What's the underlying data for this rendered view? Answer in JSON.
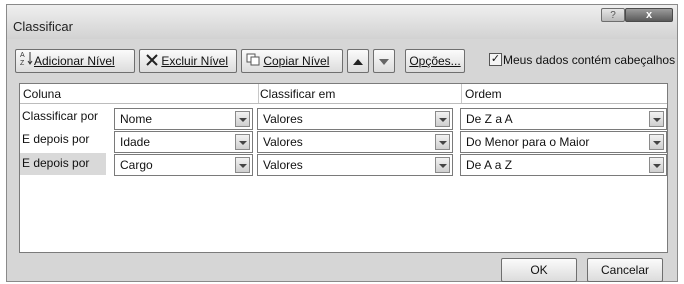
{
  "window": {
    "title": "Classificar",
    "help_label": "?",
    "close_label": "x"
  },
  "toolbar": {
    "add_level": "Adicionar Nível",
    "delete_level": "Excluir Nível",
    "copy_level": "Copiar Nível",
    "move_up_icon": "triangle-up-icon",
    "move_down_icon": "triangle-down-icon",
    "options": "Opções...",
    "has_headers_label": "Meus dados contém cabeçalhos",
    "has_headers_checked": true
  },
  "table": {
    "headers": {
      "column": "Coluna",
      "sort_on": "Classificar em",
      "order": "Ordem"
    },
    "rows": [
      {
        "label": "Classificar por",
        "column": "Nome",
        "sort_on": "Valores",
        "order": "De Z a A"
      },
      {
        "label": "E depois por",
        "column": "Idade",
        "sort_on": "Valores",
        "order": "Do Menor para o Maior"
      },
      {
        "label": "E depois por",
        "column": "Cargo",
        "sort_on": "Valores",
        "order": "De A a Z"
      }
    ]
  },
  "footer": {
    "ok": "OK",
    "cancel": "Cancelar"
  }
}
